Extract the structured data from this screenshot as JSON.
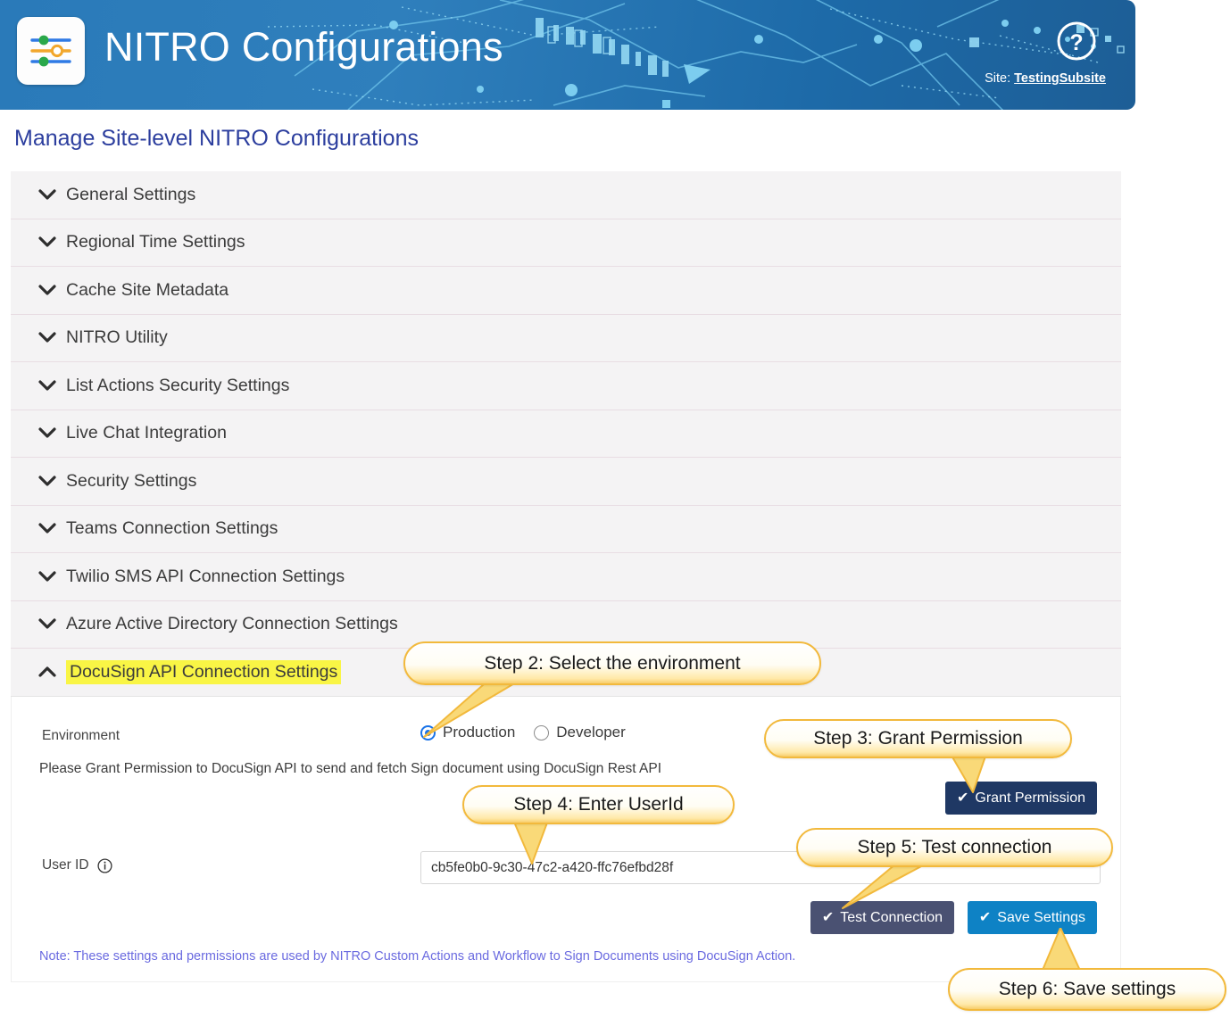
{
  "header": {
    "app_title": "NITRO Configurations",
    "logo_icon": "sliders-settings-icon",
    "help_icon": "question-mark-help-icon",
    "site_prefix": "Site:",
    "site_name": "TestingSubsite",
    "background_color": "#2a7ab9",
    "accent_color": "#5bbbe8"
  },
  "page_title": "Manage Site-level NITRO Configurations",
  "accordion": {
    "items": [
      {
        "label": "General Settings",
        "expanded": false,
        "chevron": "chevron-down-icon"
      },
      {
        "label": "Regional Time Settings",
        "expanded": false,
        "chevron": "chevron-down-icon"
      },
      {
        "label": "Cache Site Metadata",
        "expanded": false,
        "chevron": "chevron-down-icon"
      },
      {
        "label": "NITRO Utility",
        "expanded": false,
        "chevron": "chevron-down-icon"
      },
      {
        "label": "List Actions Security Settings",
        "expanded": false,
        "chevron": "chevron-down-icon"
      },
      {
        "label": "Live Chat Integration",
        "expanded": false,
        "chevron": "chevron-down-icon"
      },
      {
        "label": "Security Settings",
        "expanded": false,
        "chevron": "chevron-down-icon"
      },
      {
        "label": "Teams Connection Settings",
        "expanded": false,
        "chevron": "chevron-down-icon"
      },
      {
        "label": "Twilio SMS API Connection Settings",
        "expanded": false,
        "chevron": "chevron-down-icon"
      },
      {
        "label": "Azure Active Directory Connection Settings",
        "expanded": false,
        "chevron": "chevron-down-icon"
      },
      {
        "label": "DocuSign API Connection Settings",
        "expanded": true,
        "chevron": "chevron-up-icon",
        "highlight_color": "#f9f545"
      }
    ]
  },
  "docusign_panel": {
    "environment_label": "Environment",
    "environment_options": [
      {
        "label": "Production",
        "selected": true
      },
      {
        "label": "Developer",
        "selected": false
      }
    ],
    "grant_note": "Please Grant Permission to DocuSign API to send and fetch Sign document using DocuSign Rest API",
    "grant_button": {
      "label": "Grant Permission",
      "icon": "check-icon",
      "color": "#1f3864"
    },
    "userid_label": "User ID",
    "userid_info_icon": "info-circle-icon",
    "userid_value": "cb5fe0b0-9c30-47c2-a420-ffc76efbd28f",
    "userid_placeholder": "",
    "test_button": {
      "label": "Test Connection",
      "icon": "check-icon",
      "color": "#4a5172"
    },
    "save_button": {
      "label": "Save Settings",
      "icon": "check-icon",
      "color": "#0e82c5"
    },
    "footer_note": "Note: These settings and permissions are used by NITRO Custom Actions and Workflow to Sign Documents using DocuSign Action.",
    "footer_note_color": "#6a6ae0"
  },
  "callouts": [
    {
      "text": "Step 2: Select the environment"
    },
    {
      "text": "Step 3: Grant Permission"
    },
    {
      "text": "Step 4: Enter UserId"
    },
    {
      "text": "Step 5: Test connection"
    },
    {
      "text": "Step 6: Save settings"
    }
  ]
}
